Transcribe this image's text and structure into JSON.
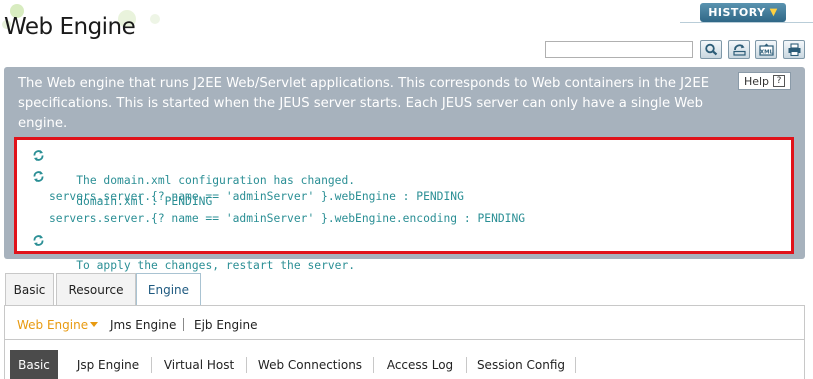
{
  "page": {
    "title": "Web Engine"
  },
  "history": {
    "label": "HISTORY"
  },
  "search": {
    "value": "",
    "placeholder": ""
  },
  "toolbar": {
    "buttons": [
      "search-icon",
      "refresh-icon",
      "export-xml-icon",
      "print-icon"
    ],
    "xml_label": "XML"
  },
  "description": {
    "text": "The Web engine that runs J2EE Web/Servlet applications. This corresponds to Web containers in the J2EE specifications. This is started when the JEUS server starts. Each JEUS server can only have a single Web engine.",
    "help_label": "Help",
    "help_glyph": "?"
  },
  "messages": [
    "The domain.xml configuration has changed.",
    "domain.xml : PENDING",
    "servers.server.{? name == 'adminServer' }.webEngine : PENDING",
    "servers.server.{? name == 'adminServer' }.webEngine.encoding : PENDING",
    "To apply the changes, restart the server."
  ],
  "colors": {
    "accent": "#e89a10",
    "message": "#2b8f95",
    "alert_border": "#e0121a",
    "panel": "#a7b2bd"
  },
  "tabs": [
    {
      "label": "Basic",
      "active": false
    },
    {
      "label": "Resource",
      "active": false
    },
    {
      "label": "Engine",
      "active": true
    }
  ],
  "subnav": [
    {
      "label": "Web Engine",
      "active": true
    },
    {
      "label": "Jms Engine",
      "active": false
    },
    {
      "label": "Ejb Engine",
      "active": false
    }
  ],
  "bottom_tabs": [
    {
      "label": "Basic",
      "active": true
    },
    {
      "label": "Jsp Engine",
      "active": false
    },
    {
      "label": "Virtual Host",
      "active": false
    },
    {
      "label": "Web Connections",
      "active": false
    },
    {
      "label": "Access Log",
      "active": false
    },
    {
      "label": "Session Config",
      "active": false
    }
  ]
}
